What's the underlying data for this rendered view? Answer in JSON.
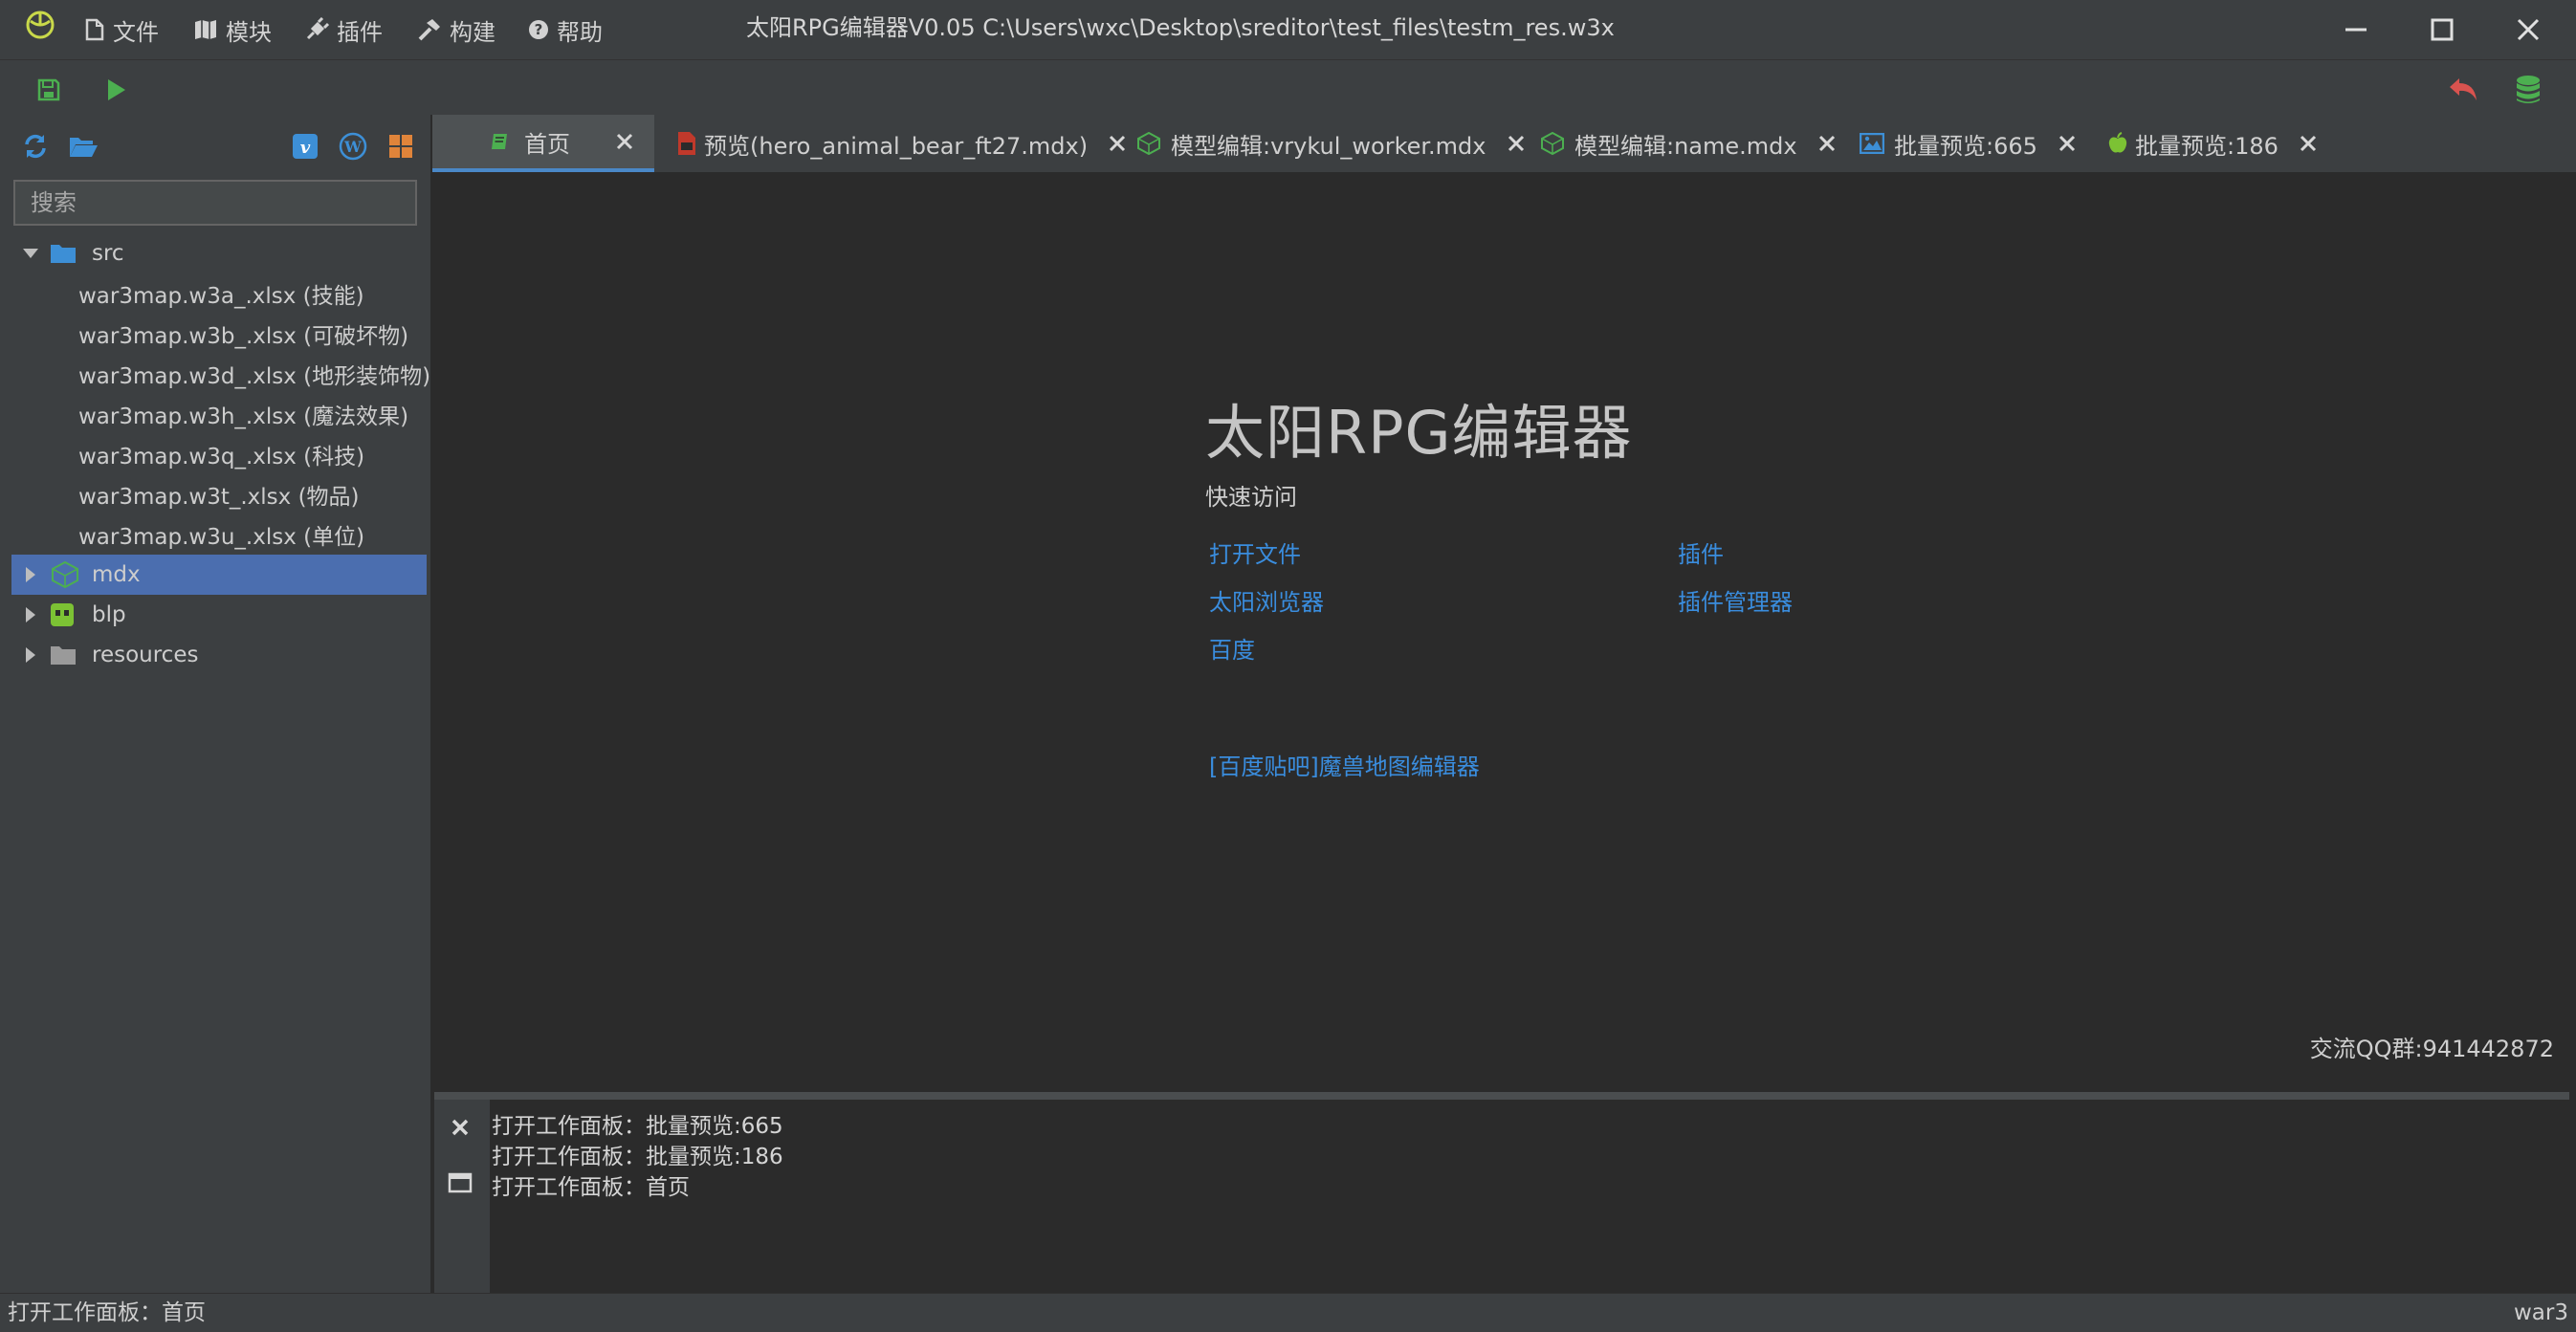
{
  "titlebar": {
    "title": "太阳RPG编辑器V0.05 C:\\Users\\wxc\\Desktop\\sreditor\\test_files\\testm_res.w3x",
    "menu": [
      {
        "label": "文件",
        "icon": "file-icon"
      },
      {
        "label": "模块",
        "icon": "map-icon"
      },
      {
        "label": "插件",
        "icon": "plug-icon"
      },
      {
        "label": "构建",
        "icon": "hammer-icon"
      },
      {
        "label": "帮助",
        "icon": "help-icon"
      }
    ]
  },
  "toolbar": {
    "left": [
      "save-icon",
      "run-icon"
    ],
    "right": [
      "undo-icon",
      "database-icon"
    ]
  },
  "sidebar": {
    "search_placeholder": "搜索",
    "tree": {
      "src": {
        "label": "src",
        "children": [
          "war3map.w3a_.xlsx (技能)",
          "war3map.w3b_.xlsx (可破坏物)",
          "war3map.w3d_.xlsx (地形装饰物)",
          "war3map.w3h_.xlsx (魔法效果)",
          "war3map.w3q_.xlsx (科技)",
          "war3map.w3t_.xlsx (物品)",
          "war3map.w3u_.xlsx (单位)"
        ]
      },
      "mdx": {
        "label": "mdx"
      },
      "blp": {
        "label": "blp"
      },
      "resources": {
        "label": "resources"
      }
    }
  },
  "tabs": [
    {
      "label": "首页",
      "active": true
    },
    {
      "label": "预览(hero_animal_bear_ft27.mdx)"
    },
    {
      "label": "模型编辑:vrykul_worker.mdx"
    },
    {
      "label": "模型编辑:name.mdx"
    },
    {
      "label": "批量预览:665"
    },
    {
      "label": "批量预览:186"
    }
  ],
  "home": {
    "title": "太阳RPG编辑器",
    "quick_access": "快速访问",
    "links": {
      "open_file": "打开文件",
      "plugins": "插件",
      "sun_browser": "太阳浏览器",
      "plugin_manager": "插件管理器",
      "baidu": "百度",
      "tieba": "[百度贴吧]魔兽地图编辑器"
    },
    "qq_group": "交流QQ群:941442872"
  },
  "log": {
    "lines": [
      "打开工作面板：批量预览:665",
      "打开工作面板：批量预览:186",
      "打开工作面板：首页"
    ]
  },
  "status": {
    "left": "打开工作面板：首页",
    "right": "war3"
  },
  "colors": {
    "background": "#2b2b2b",
    "panel": "#3c3f41",
    "selection": "#4b6eaf",
    "link": "#3a8dde",
    "accent_green": "#4caf50",
    "undo_red": "#d9534f"
  }
}
